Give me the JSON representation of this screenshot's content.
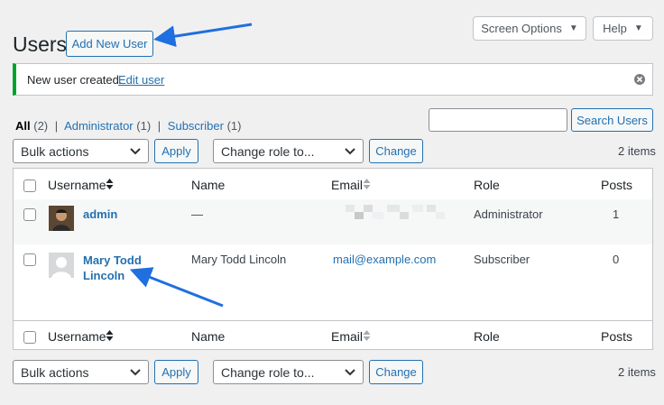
{
  "header": {
    "title": "Users",
    "add_new_label": "Add New User",
    "screen_options_label": "Screen Options",
    "help_label": "Help"
  },
  "notice": {
    "text": "New user created.",
    "link": "Edit user"
  },
  "filters": {
    "all": "All",
    "all_count": "(2)",
    "administrator": "Administrator",
    "administrator_count": "(1)",
    "subscriber": "Subscriber",
    "subscriber_count": "(1)",
    "separator": "|"
  },
  "search": {
    "value": "",
    "button_label": "Search Users"
  },
  "tablenav": {
    "bulk_actions": "Bulk actions",
    "apply_label": "Apply",
    "change_role": "Change role to...",
    "change_label": "Change",
    "items_count": "2 items"
  },
  "table": {
    "columns": {
      "username": "Username",
      "name": "Name",
      "email": "Email",
      "role": "Role",
      "posts": "Posts"
    },
    "rows": [
      {
        "username": "admin",
        "name": "—",
        "email": "",
        "role": "Administrator",
        "posts": "1"
      },
      {
        "username_line1": "Mary Todd",
        "username_line2": "Lincoln",
        "name": "Mary Todd Lincoln",
        "email": "mail@example.com",
        "role": "Subscriber",
        "posts": "0"
      }
    ]
  },
  "colors": {
    "link": "#2271b1",
    "notice_border": "#00a32a",
    "annotation_arrow": "#1f6fe0"
  }
}
